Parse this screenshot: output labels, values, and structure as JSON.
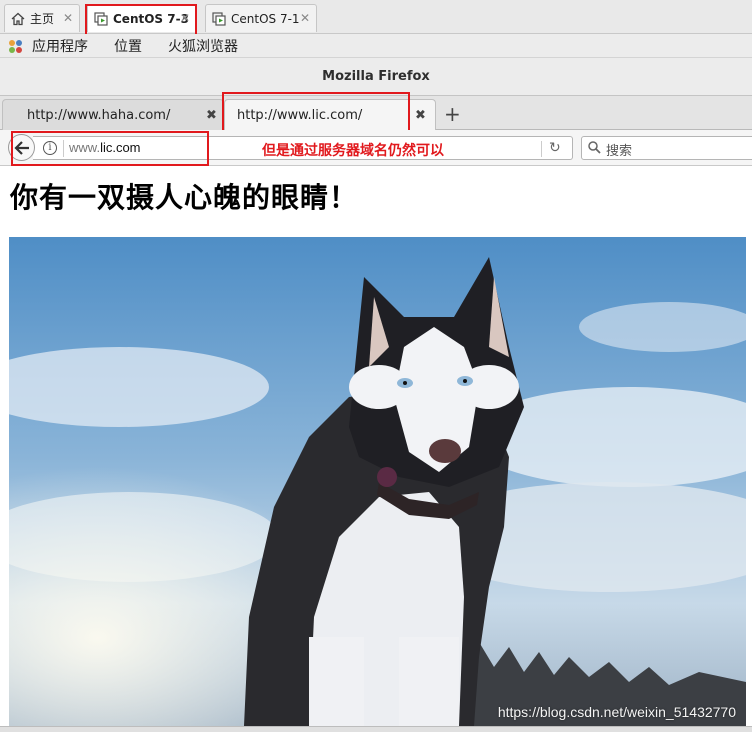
{
  "vm_tabs": [
    {
      "label": "主页",
      "icon": "home-icon",
      "active": false
    },
    {
      "label": "CentOS 7-3",
      "icon": "vm-icon",
      "active": true
    },
    {
      "label": "CentOS 7-1",
      "icon": "vm-icon",
      "active": false
    }
  ],
  "gnome_menu": {
    "applications": "应用程序",
    "places": "位置",
    "browser": "火狐浏览器"
  },
  "window_title": "Mozilla Firefox",
  "browser_tabs": [
    {
      "label": "http://www.haha.com/",
      "active": false
    },
    {
      "label": "http://www.lic.com/",
      "active": true
    }
  ],
  "nav": {
    "url_prefix": "www.",
    "url_domain": "lic.com",
    "search_placeholder": "搜索"
  },
  "annotation": "但是通过服务器域名仍然可以",
  "page": {
    "heading": "你有一双摄人心魄的眼睛！",
    "image_subject": "husky-dog-photo",
    "watermark": "https://blog.csdn.net/weixin_51432770"
  },
  "colors": {
    "annotation_red": "#e1191d",
    "sky_blue": "#5e97c8"
  }
}
